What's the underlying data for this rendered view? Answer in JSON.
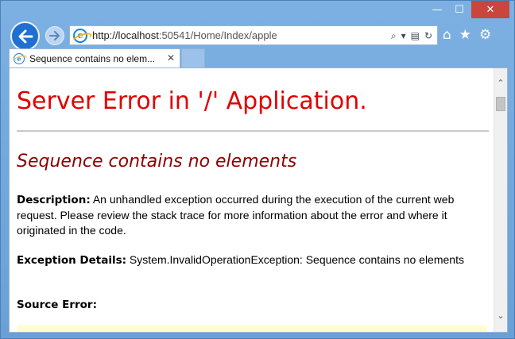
{
  "window": {
    "minimize_glyph": "—",
    "maximize_glyph": "☐",
    "close_glyph": "✕"
  },
  "toolbar": {
    "back_icon": "back-arrow-icon",
    "forward_icon": "forward-arrow-icon",
    "url_host": "http://localhost",
    "url_rest": ":50541/Home/Index/apple",
    "address_tools": {
      "search": "⌕",
      "dropdown": "▾",
      "compat": "▤",
      "refresh": "↻"
    },
    "home_glyph": "⌂",
    "favorites_glyph": "★",
    "tools_glyph": "⚙"
  },
  "tab": {
    "title": "Sequence contains no elem...",
    "close_glyph": "✕"
  },
  "page": {
    "heading": "Server Error in '/' Application.",
    "subheading": "Sequence contains no elements",
    "description_label": "Description:",
    "description_text": " An unhandled exception occurred during the execution of the current web request. Please review the stack trace for more information about the error and where it originated in the code.",
    "exception_label": "Exception Details:",
    "exception_text": " System.InvalidOperationException: Sequence contains no elements",
    "source_label": "Source Error:"
  },
  "scrollbar": {
    "up_glyph": "⌃",
    "down_glyph": "⌄"
  },
  "colors": {
    "heading": "#e10000",
    "subheading": "#8b0000",
    "source_box": "#ffffcc",
    "back_button": "#1f6fd0"
  }
}
